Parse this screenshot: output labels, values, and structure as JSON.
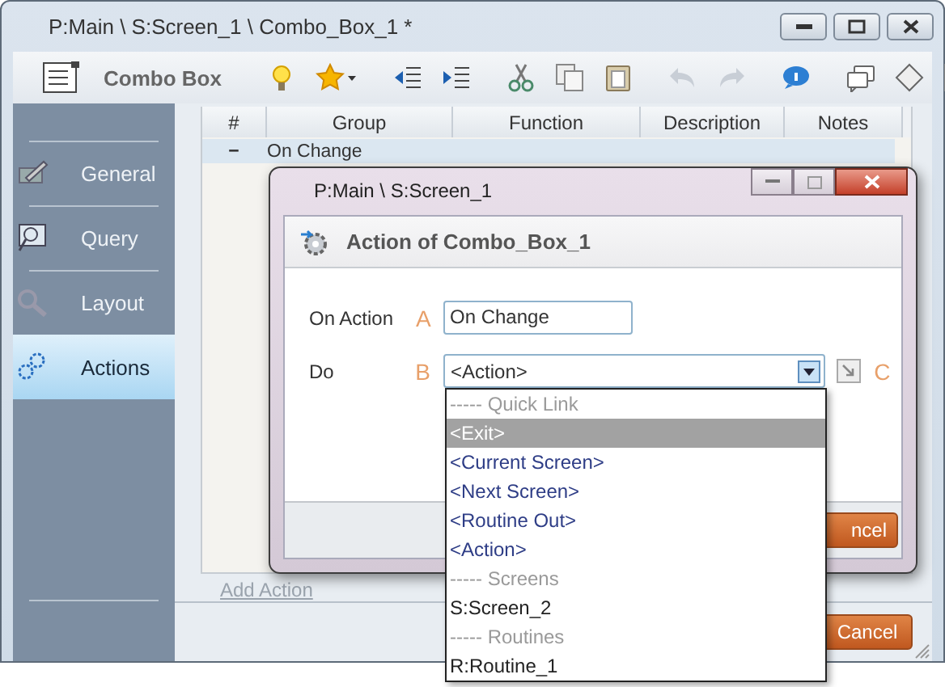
{
  "window": {
    "title": "P:Main \\ S:Screen_1 \\ Combo_Box_1 *"
  },
  "toolbar": {
    "title": "Combo Box"
  },
  "sidebar": {
    "items": [
      {
        "label": "General",
        "selected": false
      },
      {
        "label": "Query",
        "selected": false
      },
      {
        "label": "Layout",
        "selected": false
      },
      {
        "label": "Actions",
        "selected": true
      }
    ]
  },
  "table": {
    "columns": [
      "#",
      "Group",
      "Function",
      "Description",
      "Notes"
    ],
    "rows": [
      {
        "toggle": "−",
        "group": "On Change"
      }
    ]
  },
  "add_action": "Add Action",
  "main_button": "Cancel",
  "dialog": {
    "title": "P:Main \\ S:Screen_1",
    "header": "Action of Combo_Box_1",
    "fields": [
      {
        "kind": "text",
        "label": "On Action",
        "marker": "A",
        "value": "On Change"
      },
      {
        "kind": "combo",
        "label": "Do",
        "marker": "B",
        "value": "<Action>"
      }
    ],
    "extra_marker": "C",
    "button": "ncel"
  },
  "dropdown": {
    "items": [
      {
        "kind": "header",
        "label": "----- Quick Link",
        "selected": false
      },
      {
        "kind": "link",
        "label": "<Exit>",
        "selected": true
      },
      {
        "kind": "link",
        "label": "<Current Screen>",
        "selected": false
      },
      {
        "kind": "link",
        "label": "<Next Screen>",
        "selected": false
      },
      {
        "kind": "link",
        "label": "<Routine Out>",
        "selected": false
      },
      {
        "kind": "link",
        "label": "<Action>",
        "selected": false
      },
      {
        "kind": "header",
        "label": "----- Screens",
        "selected": false
      },
      {
        "kind": "item",
        "label": "S:Screen_2",
        "selected": false
      },
      {
        "kind": "header",
        "label": "----- Routines",
        "selected": false
      },
      {
        "kind": "item",
        "label": "R:Routine_1",
        "selected": false
      }
    ]
  }
}
